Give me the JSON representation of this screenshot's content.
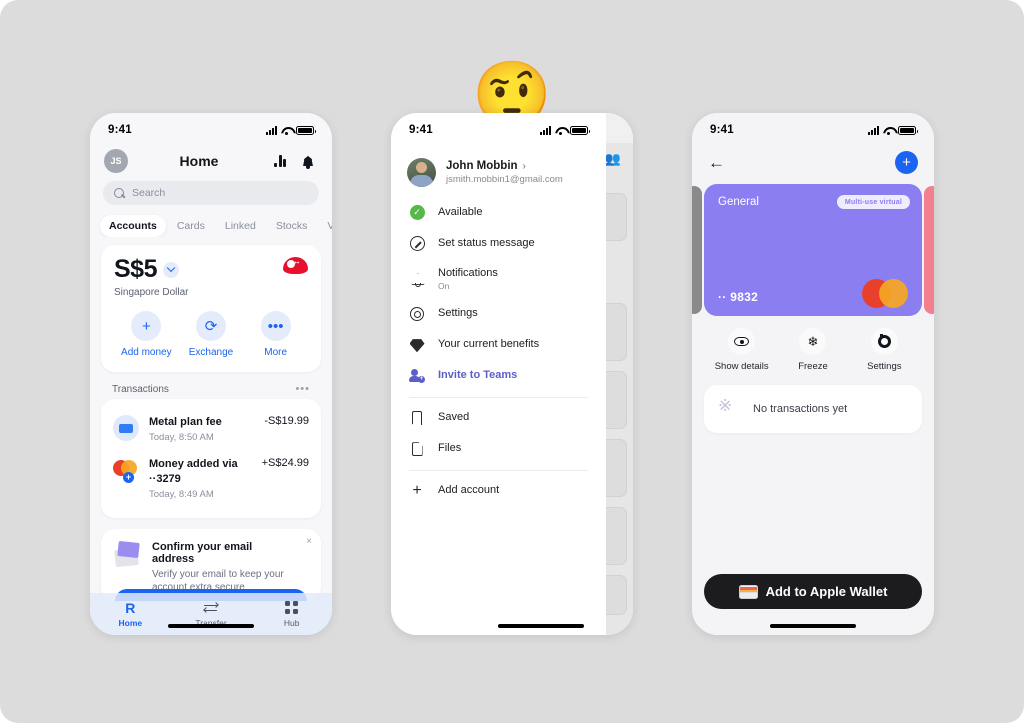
{
  "background": {
    "color": "#dcdcdc"
  },
  "decoration": {
    "emoji": "🤨",
    "emoji_name": "face-with-raised-eyebrow"
  },
  "phone1": {
    "status_bar": {
      "time": "9:41",
      "signal_icon": "cellular-signal-icon",
      "wifi_icon": "wifi-icon",
      "battery_icon": "battery-icon"
    },
    "header": {
      "avatar_initials": "JS",
      "title": "Home",
      "chart_icon": "bar-chart-icon",
      "bell_icon": "bell-icon"
    },
    "search": {
      "placeholder": "Search",
      "icon": "search-icon"
    },
    "tabs": [
      {
        "label": "Accounts",
        "active": true
      },
      {
        "label": "Cards",
        "active": false
      },
      {
        "label": "Linked",
        "active": false
      },
      {
        "label": "Stocks",
        "active": false
      },
      {
        "label": "Vaul",
        "active": false
      }
    ],
    "balance": {
      "amount": "S$5",
      "currency_name": "Singapore Dollar",
      "flag": "singapore-flag",
      "chevron": "chevron-down-icon"
    },
    "actions": [
      {
        "label": "Add money",
        "glyph": "+",
        "icon": "plus-icon"
      },
      {
        "label": "Exchange",
        "glyph": "⟳",
        "icon": "exchange-icon"
      },
      {
        "label": "More",
        "glyph": "•••",
        "icon": "more-icon"
      }
    ],
    "transactions_header": {
      "title": "Transactions",
      "more": "•••"
    },
    "transactions": [
      {
        "name": "Metal plan fee",
        "time": "Today, 8:50 AM",
        "amount": "-S$19.99",
        "icon": "card-icon"
      },
      {
        "name": "Money added via ··3279",
        "time": "Today, 8:49 AM",
        "amount": "+S$24.99",
        "icon": "mastercard-icon"
      }
    ],
    "promo": {
      "title": "Confirm your email address",
      "subtitle": "Verify your email to keep your account extra secure",
      "close": "×",
      "icon": "envelope-icon"
    },
    "nav": [
      {
        "label": "Home",
        "icon": "revolut-r-icon",
        "glyph": "R",
        "active": true
      },
      {
        "label": "Transfer",
        "icon": "transfer-arrows-icon",
        "active": false
      },
      {
        "label": "Hub",
        "icon": "grid-icon",
        "active": false
      }
    ]
  },
  "phone2": {
    "status_bar": {
      "time": "9:41"
    },
    "profile": {
      "name": "John Mobbin",
      "chevron": "›",
      "email": "jsmith.mobbin1@gmail.com",
      "avatar": "user-photo-avatar"
    },
    "menu": [
      {
        "label": "Available",
        "icon": "status-available-icon",
        "sub": "",
        "accent": false
      },
      {
        "label": "Set status message",
        "icon": "pencil-circle-icon",
        "sub": "",
        "accent": false
      },
      {
        "label": "Notifications",
        "icon": "bell-icon",
        "sub": "On",
        "accent": false
      },
      {
        "label": "Settings",
        "icon": "gear-icon",
        "sub": "",
        "accent": false
      },
      {
        "label": "Your current benefits",
        "icon": "diamond-icon",
        "sub": "",
        "accent": false
      },
      {
        "label": "Invite to Teams",
        "icon": "add-people-icon",
        "sub": "",
        "accent": true
      }
    ],
    "menu2": [
      {
        "label": "Saved",
        "icon": "bookmark-icon"
      },
      {
        "label": "Files",
        "icon": "file-icon"
      }
    ],
    "menu3": [
      {
        "label": "Add account",
        "icon": "plus-icon"
      }
    ],
    "background_app": {
      "add_people_icon": "add-people-icon"
    }
  },
  "phone3": {
    "status_bar": {
      "time": "9:41"
    },
    "header": {
      "back_icon": "back-arrow-icon",
      "back_glyph": "←",
      "add_icon": "plus-icon",
      "add_glyph": "+"
    },
    "card": {
      "name": "General",
      "badge": "Multi-use virtual",
      "number": "·· 9832",
      "network_icon": "mastercard-icon",
      "color": "#8b7ef0",
      "neighbor_left_color": "#8a8a8a",
      "neighbor_right_color": "#f2808f"
    },
    "actions": [
      {
        "label": "Show details",
        "icon": "eye-icon"
      },
      {
        "label": "Freeze",
        "icon": "snowflake-icon",
        "glyph": "❄"
      },
      {
        "label": "Settings",
        "icon": "gear-icon"
      }
    ],
    "empty_state": {
      "text": "No transactions yet",
      "icon": "empty-transactions-icon"
    },
    "wallet_button": {
      "label": "Add to Apple Wallet",
      "icon": "apple-wallet-icon"
    }
  }
}
